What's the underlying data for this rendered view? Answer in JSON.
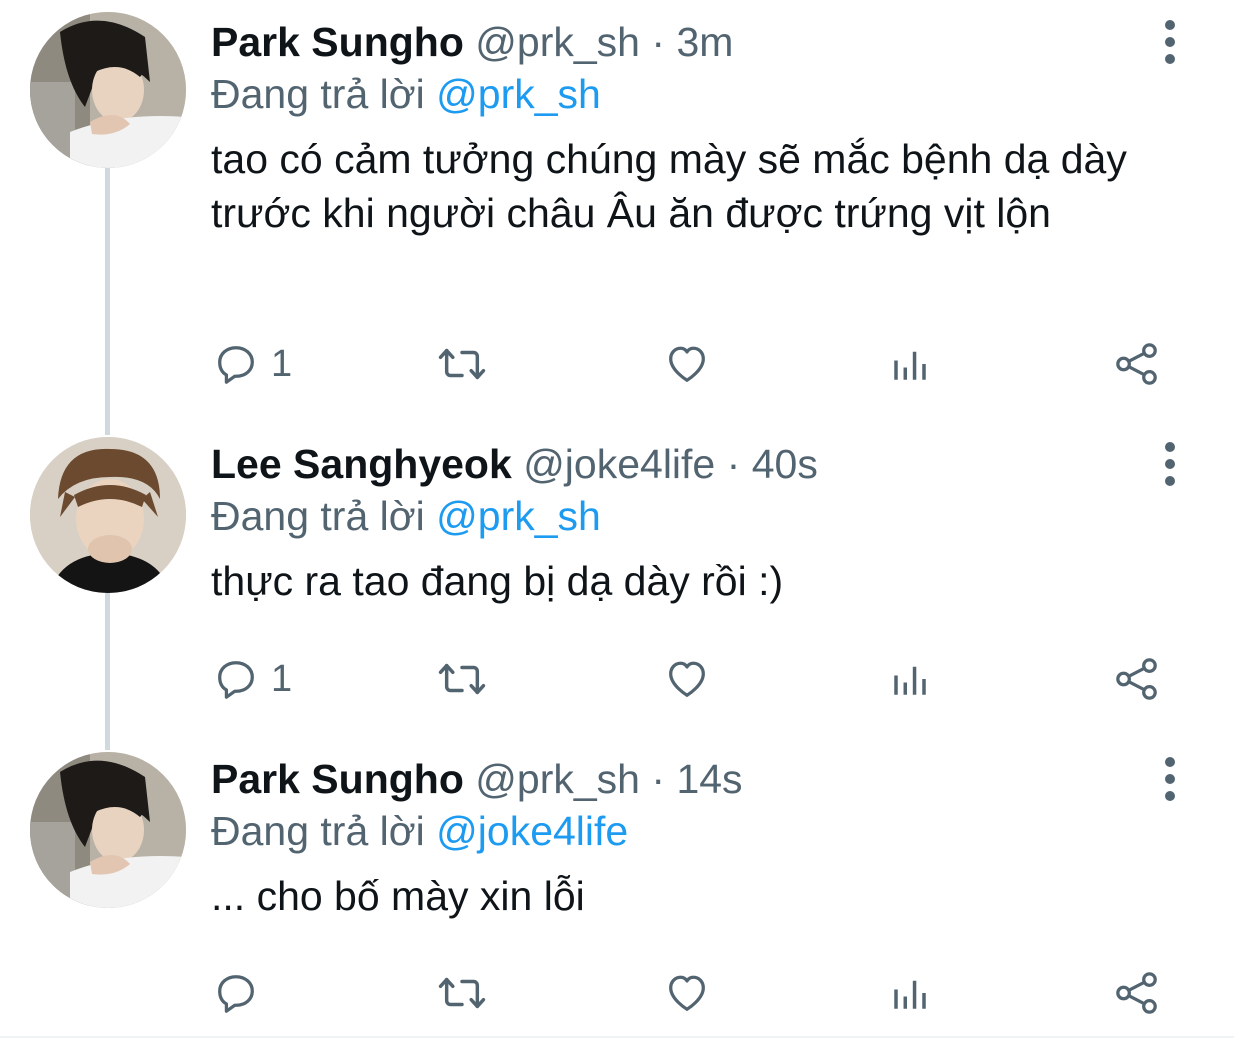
{
  "tweets": [
    {
      "name": "Park Sungho",
      "handle": "@prk_sh",
      "separator": "·",
      "time": "3m",
      "reply_prefix": "Đang trả lời",
      "reply_to": "@prk_sh",
      "text": "tao có cảm tưởng chúng mày sẽ mắc bệnh dạ dày trước khi người châu Âu ăn được trứng vịt lộn",
      "reply_count": "1",
      "avatar": "avatar-park-sungho"
    },
    {
      "name": "Lee Sanghyeok",
      "handle": "@joke4life",
      "separator": "·",
      "time": "40s",
      "reply_prefix": "Đang trả lời",
      "reply_to": "@prk_sh",
      "text": "thực ra tao đang bị dạ dày rồi :)",
      "reply_count": "1",
      "avatar": "avatar-lee-sanghyeok"
    },
    {
      "name": "Park Sungho",
      "handle": "@prk_sh",
      "separator": "·",
      "time": "14s",
      "reply_prefix": "Đang trả lời",
      "reply_to": "@joke4life",
      "text": "... cho bố mày xin lỗi",
      "reply_count": "",
      "avatar": "avatar-park-sungho"
    }
  ],
  "icons": {
    "reply": "reply-icon",
    "retweet": "retweet-icon",
    "like": "heart-icon",
    "views": "analytics-icon",
    "share": "share-icon",
    "more": "more-vertical-icon"
  },
  "colors": {
    "text": "#0f1419",
    "secondary": "#536471",
    "mention": "#1d9bf0",
    "thread_line": "#cfd9de"
  }
}
